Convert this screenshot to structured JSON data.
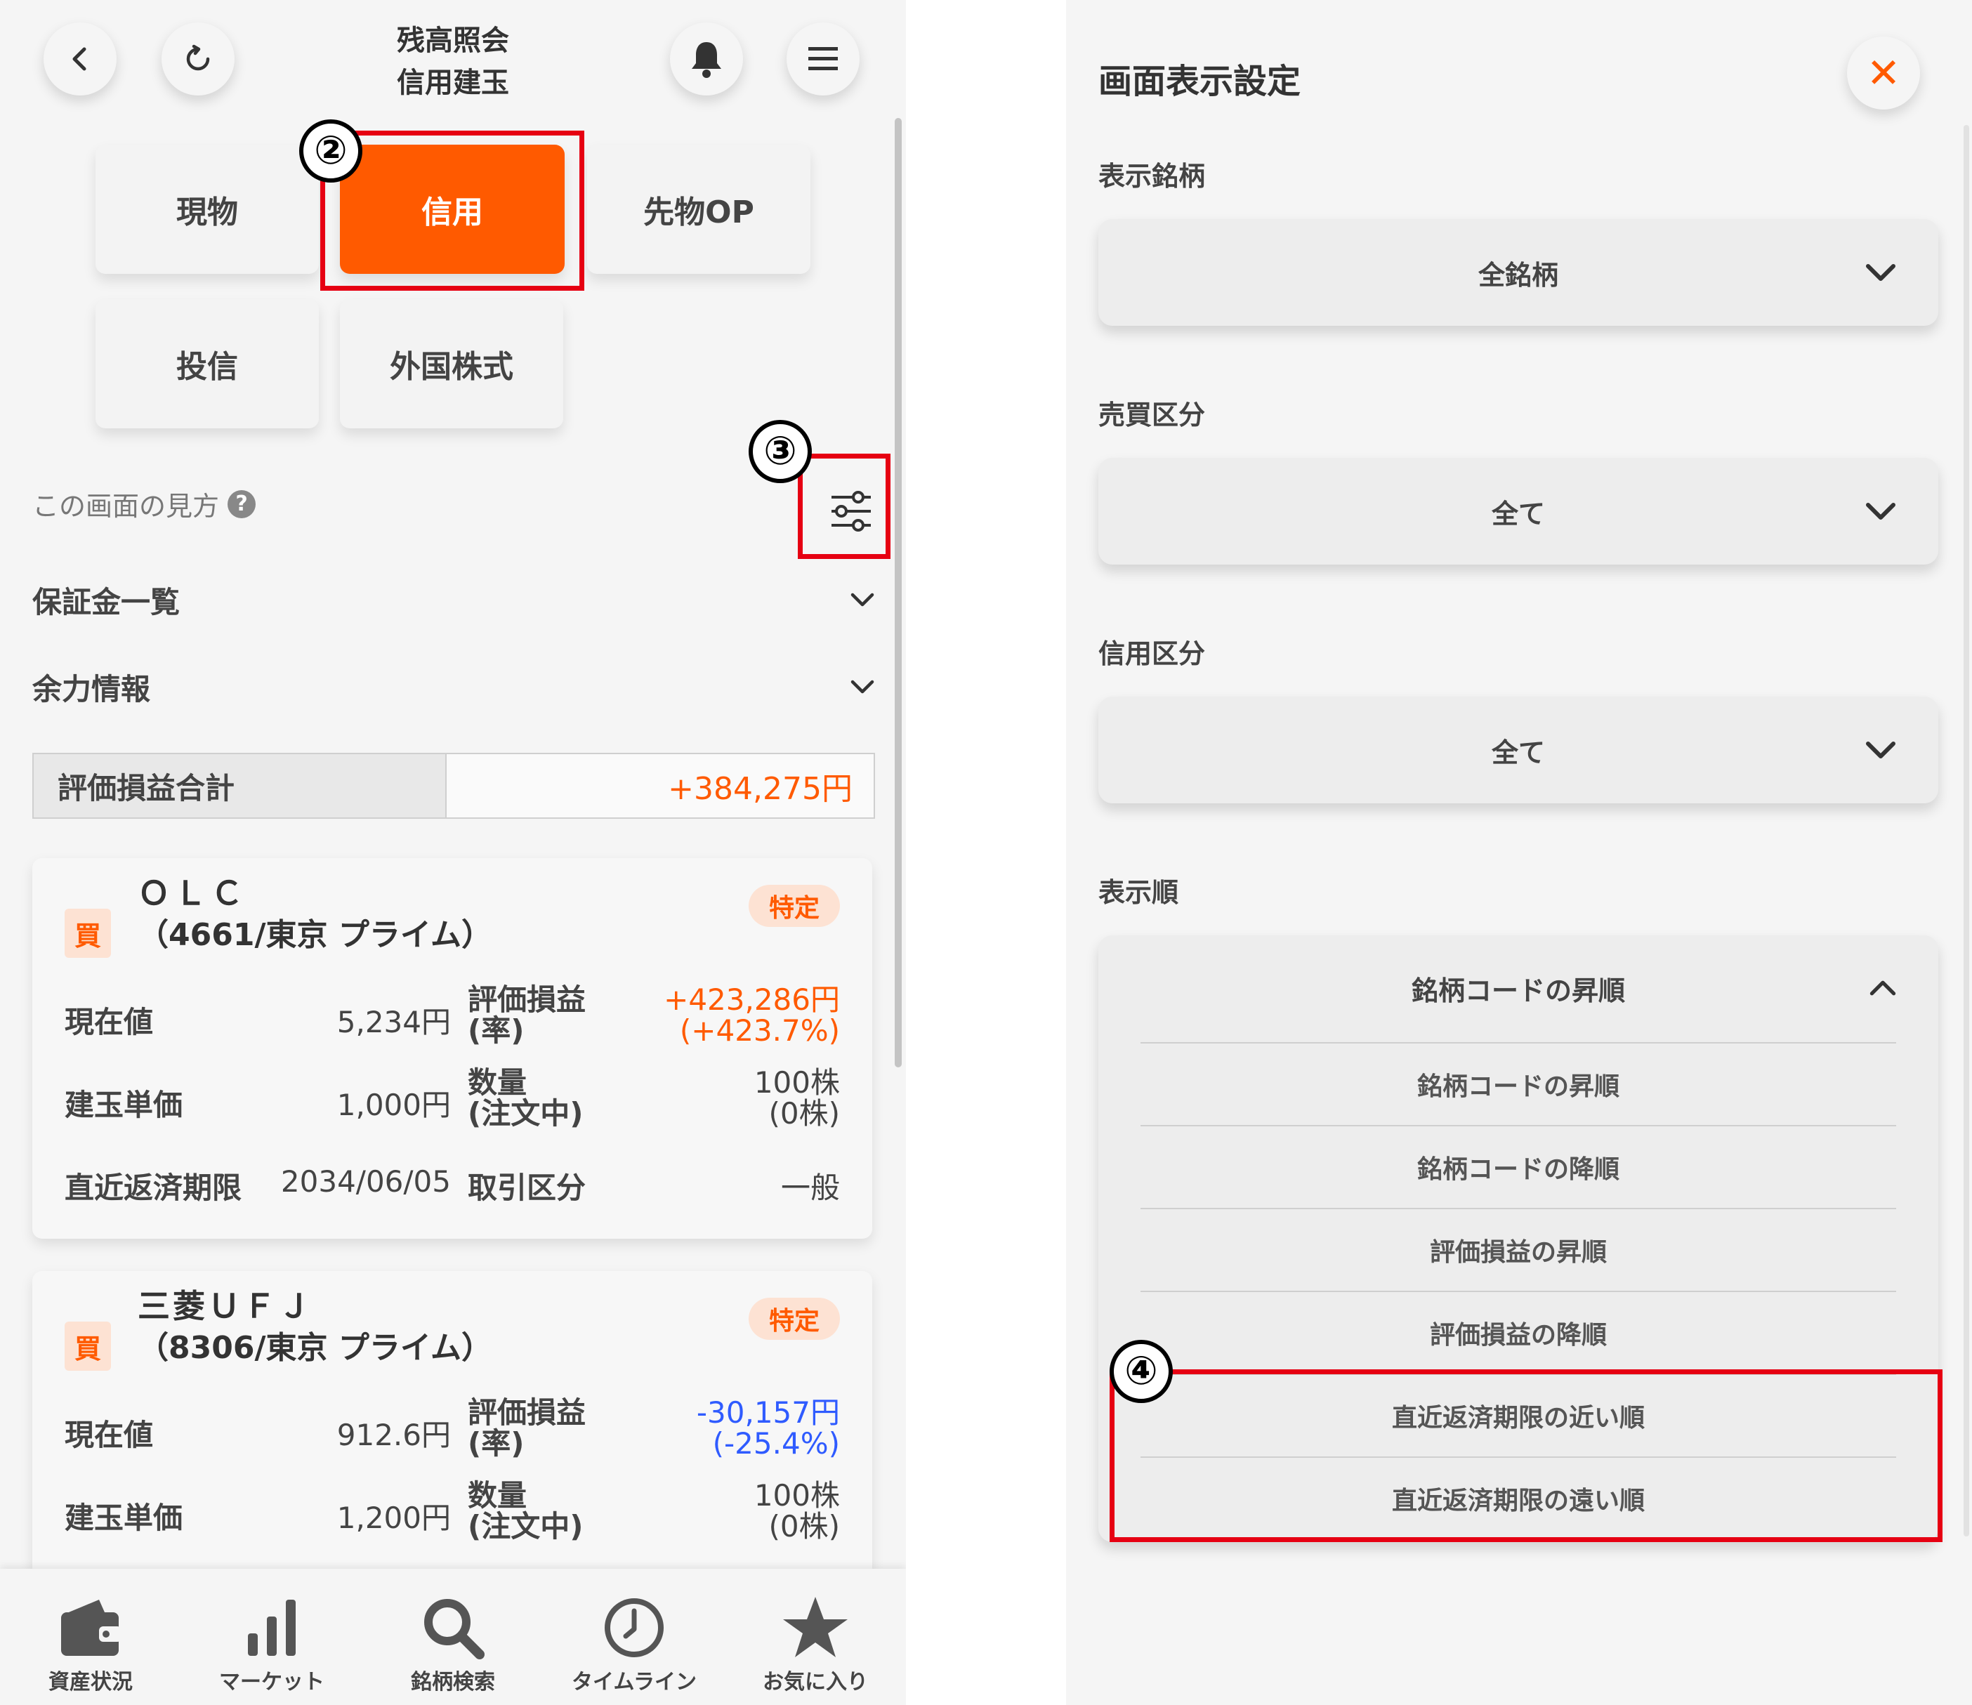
{
  "left": {
    "header": {
      "title_line1": "残高照会",
      "title_line2": "信用建玉",
      "back_icon": "chevron-left-icon",
      "reload_icon": "reload-icon",
      "bell_icon": "bell-icon",
      "menu_icon": "hamburger-icon"
    },
    "tabs": [
      {
        "label": "現物",
        "active": false
      },
      {
        "label": "信用",
        "active": true
      },
      {
        "label": "先物OP",
        "active": false
      },
      {
        "label": "投信",
        "active": false
      },
      {
        "label": "外国株式",
        "active": false
      }
    ],
    "help_text": "この画面の見方",
    "help_icon": "?",
    "accordions": [
      {
        "label": "保証金一覧"
      },
      {
        "label": "余力情報"
      }
    ],
    "total": {
      "label": "評価損益合計",
      "value": "+384,275円"
    },
    "cards": [
      {
        "side": "買",
        "tag": "特定",
        "name": "ＯＬＣ",
        "code": "（4661/東京 プライム）",
        "current_price_label": "現在値",
        "current_price": "5,234円",
        "pl_label_1": "評価損益",
        "pl_label_2": "(率)",
        "pl_value": "+423,286円",
        "pl_rate": "(+423.7%)",
        "unit_price_label": "建玉単価",
        "unit_price": "1,000円",
        "qty_label_1": "数量",
        "qty_label_2": "(注文中)",
        "qty_value": "100株",
        "qty_pending": "(0株)",
        "deadline_label": "直近返済期限",
        "deadline": "2034/06/05",
        "trade_label": "取引区分",
        "trade_value": "一般"
      },
      {
        "side": "買",
        "tag": "特定",
        "name": "三菱ＵＦＪ",
        "code": "（8306/東京 プライム）",
        "current_price_label": "現在値",
        "current_price": "912.6円",
        "pl_label_1": "評価損益",
        "pl_label_2": "(率)",
        "pl_value": "-30,157円",
        "pl_rate": "(-25.4%)",
        "unit_price_label": "建玉単価",
        "unit_price": "1,200円",
        "qty_label_1": "数量",
        "qty_label_2": "(注文中)",
        "qty_value": "100株",
        "qty_pending": "(0株)"
      }
    ],
    "bottom_nav": [
      {
        "label": "資産状況",
        "icon": "wallet-icon"
      },
      {
        "label": "マーケット",
        "icon": "bar-chart-icon"
      },
      {
        "label": "銘柄検索",
        "icon": "search-icon"
      },
      {
        "label": "タイムライン",
        "icon": "clock-icon"
      },
      {
        "label": "お気に入り",
        "icon": "star-icon"
      }
    ],
    "callouts": {
      "c2": "②",
      "c3": "③"
    }
  },
  "right": {
    "title": "画面表示設定",
    "close_icon": "✕",
    "sections": [
      {
        "label": "表示銘柄",
        "value": "全銘柄"
      },
      {
        "label": "売買区分",
        "value": "全て"
      },
      {
        "label": "信用区分",
        "value": "全て"
      }
    ],
    "order": {
      "label": "表示順",
      "selected": "銘柄コードの昇順",
      "options": [
        "銘柄コードの昇順",
        "銘柄コードの降順",
        "評価損益の昇順",
        "評価損益の降順",
        "直近返済期限の近い順",
        "直近返済期限の遠い順"
      ]
    },
    "callout": "④"
  },
  "colors": {
    "accent": "#ff5a00",
    "highlight": "#e60012",
    "positive": "#ff5a00",
    "negative": "#2f5bff"
  }
}
